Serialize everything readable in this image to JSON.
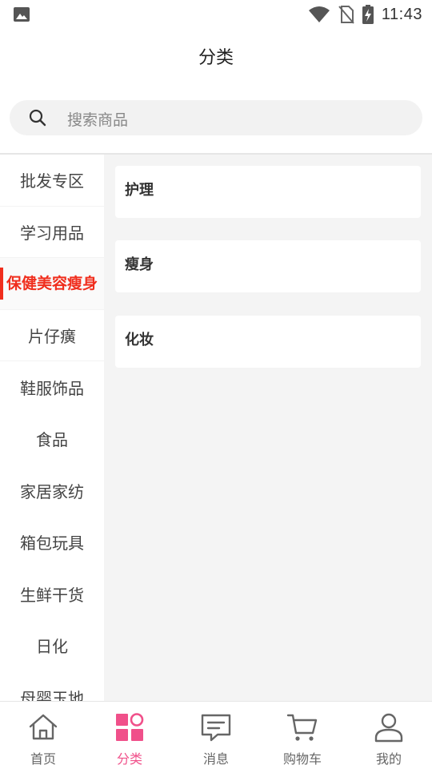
{
  "status_bar": {
    "time": "11:43"
  },
  "header": {
    "title": "分类"
  },
  "search": {
    "placeholder": "搜索商品"
  },
  "sidebar": {
    "items": [
      {
        "label": "批发专区"
      },
      {
        "label": "学习用品"
      },
      {
        "label": "保健美容瘦身"
      },
      {
        "label": "片仔癀"
      },
      {
        "label": "鞋服饰品"
      },
      {
        "label": "食品"
      },
      {
        "label": "家居家纺"
      },
      {
        "label": "箱包玩具"
      },
      {
        "label": "生鲜干货"
      },
      {
        "label": "日化"
      },
      {
        "label": "母婴玉地"
      }
    ],
    "active_index": 2
  },
  "categories": [
    {
      "label": "护理"
    },
    {
      "label": "瘦身"
    },
    {
      "label": "化妆"
    }
  ],
  "tabbar": {
    "tabs": [
      {
        "label": "首页",
        "icon": "home-icon"
      },
      {
        "label": "分类",
        "icon": "category-icon"
      },
      {
        "label": "消息",
        "icon": "message-icon"
      },
      {
        "label": "购物车",
        "icon": "cart-icon"
      },
      {
        "label": "我的",
        "icon": "user-icon"
      }
    ],
    "active_index": 1
  },
  "colors": {
    "active_red": "#f02e1d",
    "tab_active_pink": "#f0508a"
  }
}
